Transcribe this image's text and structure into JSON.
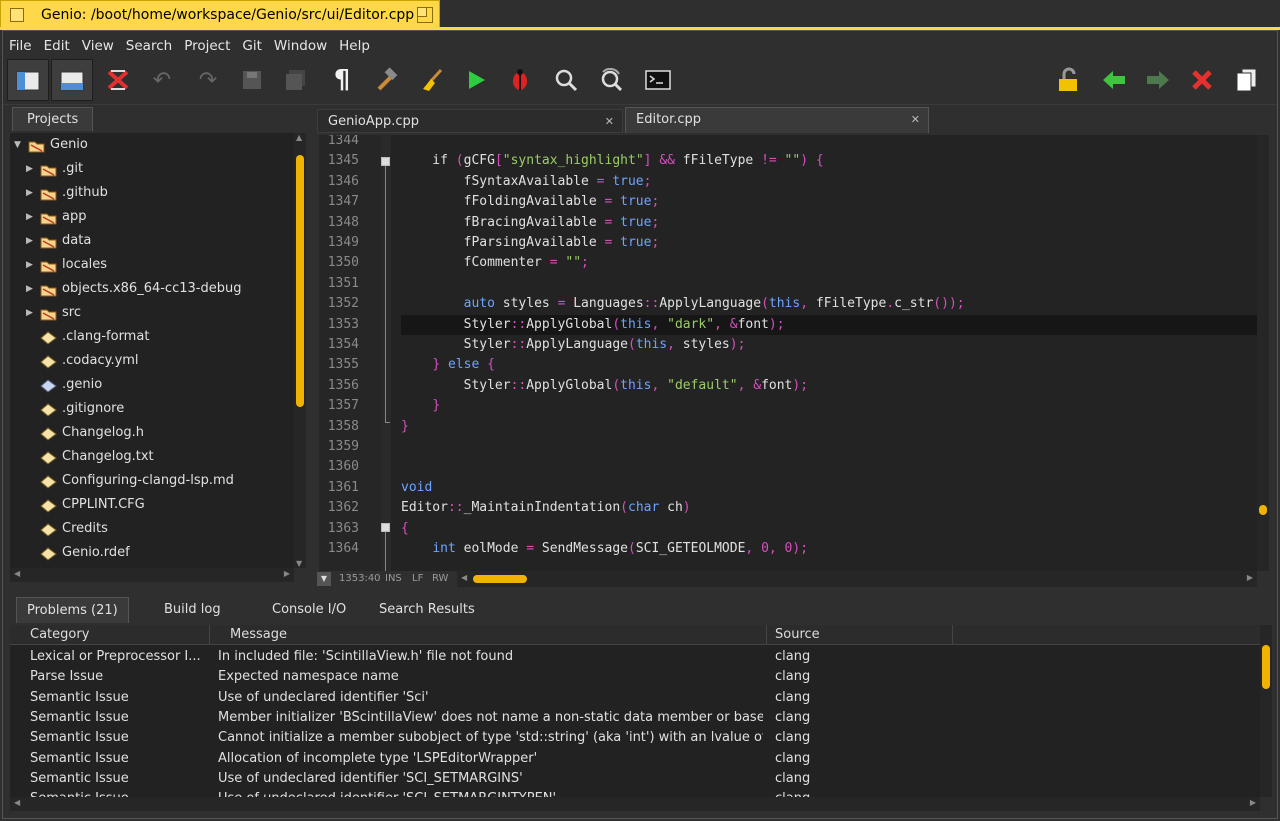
{
  "window": {
    "title": "Genio: /boot/home/workspace/Genio/src/ui/Editor.cpp"
  },
  "menu": [
    "File",
    "Edit",
    "View",
    "Search",
    "Project",
    "Git",
    "Window",
    "Help"
  ],
  "colors": {
    "accent": "#ffd84a",
    "scroll_thumb": "#f0b400",
    "keyword": "#6ea3ff",
    "string": "#9acd68",
    "punct": "#d54fbf"
  },
  "toolbar": {
    "left": [
      "projects-panel-icon",
      "output-panel-icon",
      "focus-mode-icon",
      "undo-icon",
      "redo-icon",
      "save-icon",
      "save-all-icon",
      "show-whitespace-icon",
      "build-hammer-icon",
      "clean-broom-icon",
      "run-play-icon",
      "debug-bug-icon",
      "find-icon",
      "replace-icon",
      "terminal-icon"
    ],
    "right": [
      "unlock-icon",
      "back-arrow-icon",
      "forward-arrow-icon",
      "close-red-x-icon",
      "duplicate-icon"
    ]
  },
  "projects": {
    "tab_label": "Projects",
    "items": [
      {
        "label": "Genio",
        "type": "folder",
        "expanded": true,
        "level": 0
      },
      {
        "label": ".git",
        "type": "folder",
        "level": 1
      },
      {
        "label": ".github",
        "type": "folder",
        "level": 1
      },
      {
        "label": "app",
        "type": "folder",
        "level": 1
      },
      {
        "label": "data",
        "type": "folder",
        "level": 1
      },
      {
        "label": "locales",
        "type": "folder",
        "level": 1
      },
      {
        "label": "objects.x86_64-cc13-debug",
        "type": "folder",
        "level": 1
      },
      {
        "label": "src",
        "type": "folder",
        "level": 1
      },
      {
        "label": ".clang-format",
        "type": "file",
        "level": 1
      },
      {
        "label": ".codacy.yml",
        "type": "file",
        "level": 1
      },
      {
        "label": ".genio",
        "type": "genio",
        "level": 1
      },
      {
        "label": ".gitignore",
        "type": "file",
        "level": 1
      },
      {
        "label": "Changelog.h",
        "type": "file",
        "level": 1
      },
      {
        "label": "Changelog.txt",
        "type": "file",
        "level": 1
      },
      {
        "label": "Configuring-clangd-lsp.md",
        "type": "file",
        "level": 1
      },
      {
        "label": "CPPLINT.CFG",
        "type": "file",
        "level": 1
      },
      {
        "label": "Credits",
        "type": "file",
        "level": 1
      },
      {
        "label": "Genio.rdef",
        "type": "file",
        "level": 1
      }
    ]
  },
  "editor": {
    "tabs": [
      {
        "label": "GenioApp.cpp",
        "active": false
      },
      {
        "label": "Editor.cpp",
        "active": true
      }
    ],
    "current_line": "1353",
    "status": {
      "position": "1353:40",
      "mode": "INS",
      "eol": "LF",
      "rw": "RW"
    },
    "lines": [
      {
        "n": "1344",
        "code": []
      },
      {
        "n": "1345",
        "code": [
          [
            "n",
            "    if "
          ],
          [
            "p",
            "("
          ],
          [
            "n",
            "gCFG"
          ],
          [
            "p",
            "["
          ],
          [
            "s",
            "\"syntax_highlight\""
          ],
          [
            "p",
            "]"
          ],
          [
            "n",
            " "
          ],
          [
            "p",
            "&&"
          ],
          [
            "n",
            " fFileType "
          ],
          [
            "p",
            "!="
          ],
          [
            "n",
            " "
          ],
          [
            "s",
            "\"\""
          ],
          [
            "p",
            ")"
          ],
          [
            "n",
            " "
          ],
          [
            "p",
            "{"
          ]
        ]
      },
      {
        "n": "1346",
        "code": [
          [
            "n",
            "        fSyntaxAvailable "
          ],
          [
            "p",
            "="
          ],
          [
            "n",
            " "
          ],
          [
            "k",
            "true"
          ],
          [
            "p",
            ";"
          ]
        ]
      },
      {
        "n": "1347",
        "code": [
          [
            "n",
            "        fFoldingAvailable "
          ],
          [
            "p",
            "="
          ],
          [
            "n",
            " "
          ],
          [
            "k",
            "true"
          ],
          [
            "p",
            ";"
          ]
        ]
      },
      {
        "n": "1348",
        "code": [
          [
            "n",
            "        fBracingAvailable "
          ],
          [
            "p",
            "="
          ],
          [
            "n",
            " "
          ],
          [
            "k",
            "true"
          ],
          [
            "p",
            ";"
          ]
        ]
      },
      {
        "n": "1349",
        "code": [
          [
            "n",
            "        fParsingAvailable "
          ],
          [
            "p",
            "="
          ],
          [
            "n",
            " "
          ],
          [
            "k",
            "true"
          ],
          [
            "p",
            ";"
          ]
        ]
      },
      {
        "n": "1350",
        "code": [
          [
            "n",
            "        fCommenter "
          ],
          [
            "p",
            "="
          ],
          [
            "n",
            " "
          ],
          [
            "s",
            "\"\""
          ],
          [
            "p",
            ";"
          ]
        ]
      },
      {
        "n": "1351",
        "code": []
      },
      {
        "n": "1352",
        "code": [
          [
            "n",
            "        "
          ],
          [
            "k",
            "auto"
          ],
          [
            "n",
            " styles "
          ],
          [
            "p",
            "="
          ],
          [
            "n",
            " Languages"
          ],
          [
            "p",
            "::"
          ],
          [
            "n",
            "ApplyLanguage"
          ],
          [
            "p",
            "("
          ],
          [
            "k",
            "this"
          ],
          [
            "p",
            ","
          ],
          [
            "n",
            " fFileType"
          ],
          [
            "p",
            "."
          ],
          [
            "n",
            "c_str"
          ],
          [
            "p",
            "());"
          ]
        ]
      },
      {
        "n": "1353",
        "code": [
          [
            "n",
            "        Styler"
          ],
          [
            "p",
            "::"
          ],
          [
            "n",
            "ApplyGlobal"
          ],
          [
            "p",
            "("
          ],
          [
            "k",
            "this"
          ],
          [
            "p",
            ","
          ],
          [
            "n",
            " "
          ],
          [
            "s",
            "\"dark\""
          ],
          [
            "p",
            ","
          ],
          [
            "n",
            " "
          ],
          [
            "p",
            "&"
          ],
          [
            "n",
            "font"
          ],
          [
            "p",
            ");"
          ]
        ]
      },
      {
        "n": "1354",
        "code": [
          [
            "n",
            "        Styler"
          ],
          [
            "p",
            "::"
          ],
          [
            "n",
            "ApplyLanguage"
          ],
          [
            "p",
            "("
          ],
          [
            "k",
            "this"
          ],
          [
            "p",
            ","
          ],
          [
            "n",
            " styles"
          ],
          [
            "p",
            ");"
          ]
        ]
      },
      {
        "n": "1355",
        "code": [
          [
            "n",
            "    "
          ],
          [
            "p",
            "}"
          ],
          [
            "n",
            " "
          ],
          [
            "k",
            "else"
          ],
          [
            "n",
            " "
          ],
          [
            "p",
            "{"
          ]
        ]
      },
      {
        "n": "1356",
        "code": [
          [
            "n",
            "        Styler"
          ],
          [
            "p",
            "::"
          ],
          [
            "n",
            "ApplyGlobal"
          ],
          [
            "p",
            "("
          ],
          [
            "k",
            "this"
          ],
          [
            "p",
            ","
          ],
          [
            "n",
            " "
          ],
          [
            "s",
            "\"default\""
          ],
          [
            "p",
            ","
          ],
          [
            "n",
            " "
          ],
          [
            "p",
            "&"
          ],
          [
            "n",
            "font"
          ],
          [
            "p",
            ");"
          ]
        ]
      },
      {
        "n": "1357",
        "code": [
          [
            "n",
            "    "
          ],
          [
            "p",
            "}"
          ]
        ]
      },
      {
        "n": "1358",
        "code": [
          [
            "p",
            "}"
          ]
        ]
      },
      {
        "n": "1359",
        "code": []
      },
      {
        "n": "1360",
        "code": []
      },
      {
        "n": "1361",
        "code": [
          [
            "k",
            "void"
          ]
        ]
      },
      {
        "n": "1362",
        "code": [
          [
            "n",
            "Editor"
          ],
          [
            "p",
            "::"
          ],
          [
            "n",
            "_MaintainIndentation"
          ],
          [
            "p",
            "("
          ],
          [
            "k",
            "char"
          ],
          [
            "n",
            " ch"
          ],
          [
            "p",
            ")"
          ]
        ]
      },
      {
        "n": "1363",
        "code": [
          [
            "p",
            "{"
          ]
        ]
      },
      {
        "n": "1364",
        "code": [
          [
            "n",
            "    "
          ],
          [
            "k",
            "int"
          ],
          [
            "n",
            " eolMode "
          ],
          [
            "p",
            "="
          ],
          [
            "n",
            " SendMessage"
          ],
          [
            "p",
            "("
          ],
          [
            "n",
            "SCI_GETEOLMODE"
          ],
          [
            "p",
            ","
          ],
          [
            "n",
            " "
          ],
          [
            "p",
            "0"
          ],
          [
            "p",
            ","
          ],
          [
            "n",
            " "
          ],
          [
            "p",
            "0"
          ],
          [
            "p",
            ");"
          ]
        ]
      }
    ]
  },
  "bottom": {
    "tabs": [
      "Problems (21)",
      "Build log",
      "Console I/O",
      "Search Results"
    ],
    "columns": [
      "Category",
      "Message",
      "Source"
    ],
    "rows": [
      [
        "Lexical or Preprocessor I...",
        "In included file: 'ScintillaView.h' file not found",
        "clang"
      ],
      [
        "Parse Issue",
        "Expected namespace name",
        "clang"
      ],
      [
        "Semantic Issue",
        "Use of undeclared identifier 'Sci'",
        "clang"
      ],
      [
        "Semantic Issue",
        "Member initializer 'BScintillaView' does not name a non-static data member or base ...",
        "clang"
      ],
      [
        "Semantic Issue",
        "Cannot initialize a member subobject of type 'std::string' (aka 'int') with an lvalue of t...",
        "clang"
      ],
      [
        "Semantic Issue",
        "Allocation of incomplete type 'LSPEditorWrapper'",
        "clang"
      ],
      [
        "Semantic Issue",
        "Use of undeclared identifier 'SCI_SETMARGINS'",
        "clang"
      ],
      [
        "Semantic Issue",
        "Use of undeclared identifier 'SCI_SETMARGINTYPEN'",
        "clang"
      ]
    ]
  }
}
